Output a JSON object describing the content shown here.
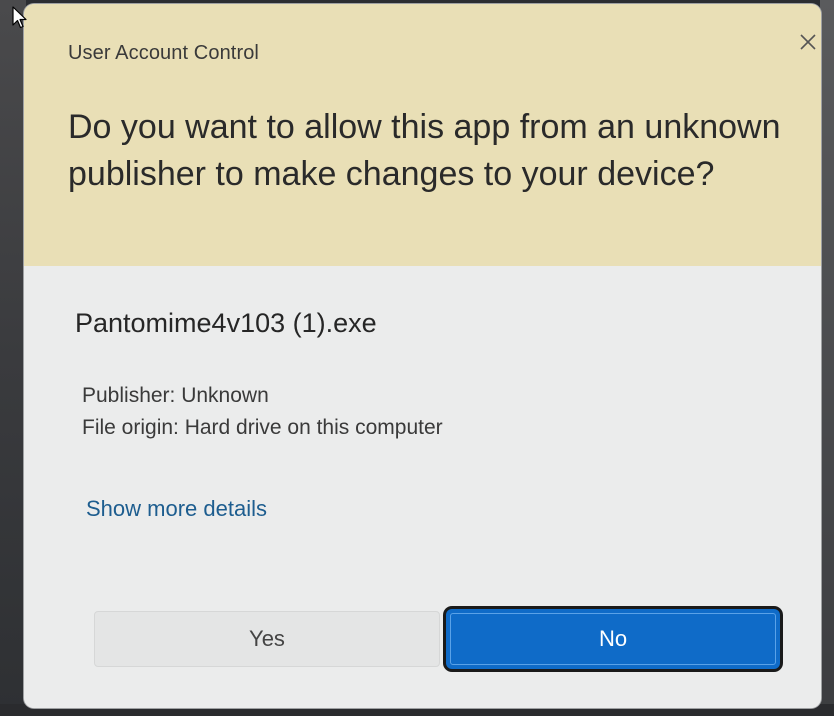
{
  "dialog": {
    "title": "User Account Control",
    "question": "Do you want to allow this app from an unknown publisher to make changes to your device?",
    "app_name": "Pantomime4v103 (1).exe",
    "publisher": "Publisher: Unknown",
    "file_origin": "File origin: Hard drive on this computer",
    "details_link": "Show more details",
    "yes_label": "Yes",
    "no_label": "No"
  },
  "icons": {
    "close": "close-icon",
    "cursor": "mouse-cursor-icon"
  },
  "colors": {
    "header_bg": "#e9dfb6",
    "body_bg": "#ebecec",
    "primary_button": "#0f6bc8",
    "link": "#1d5d8f"
  }
}
